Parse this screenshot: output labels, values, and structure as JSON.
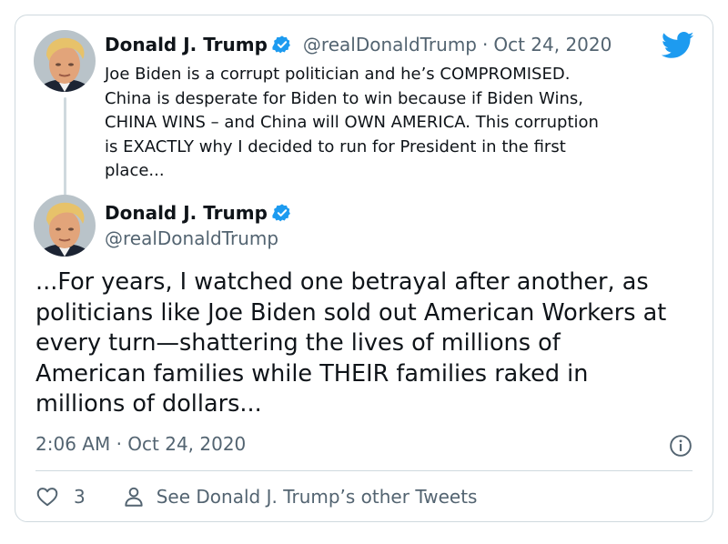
{
  "colors": {
    "text": "#0f1419",
    "secondary": "#536471",
    "twitter_blue": "#1d9bf0",
    "border": "#cfd9de"
  },
  "logo": {
    "icon": "twitter-bird-icon"
  },
  "quoted_tweet": {
    "display_name": "Donald J. Trump",
    "handle": "@realDonaldTrump",
    "separator": "·",
    "date": "Oct 24, 2020",
    "lines": [
      "Joe Biden is a corrupt politician and he’s COMPROMISED.",
      "China is desperate for Biden to win because if Biden Wins,",
      "CHINA WINS – and China will OWN AMERICA. This corruption",
      "is EXACTLY why I decided to run for President in the first",
      "place..."
    ]
  },
  "main_tweet": {
    "display_name": "Donald J. Trump",
    "handle": "@realDonaldTrump",
    "lines": [
      "...For years, I watched one betrayal after another, as",
      "politicians like Joe Biden sold out American Workers at",
      "every turn—shattering the lives of millions of",
      "American families while THEIR families raked in",
      "millions of dollars..."
    ],
    "timestamp": "2:06 AM · Oct 24, 2020",
    "info_icon": "info-icon"
  },
  "actions": {
    "like_icon": "heart-icon",
    "like_count": "3",
    "profile_icon": "person-icon",
    "other_tweets_label": "See Donald J. Trump’s other Tweets"
  }
}
